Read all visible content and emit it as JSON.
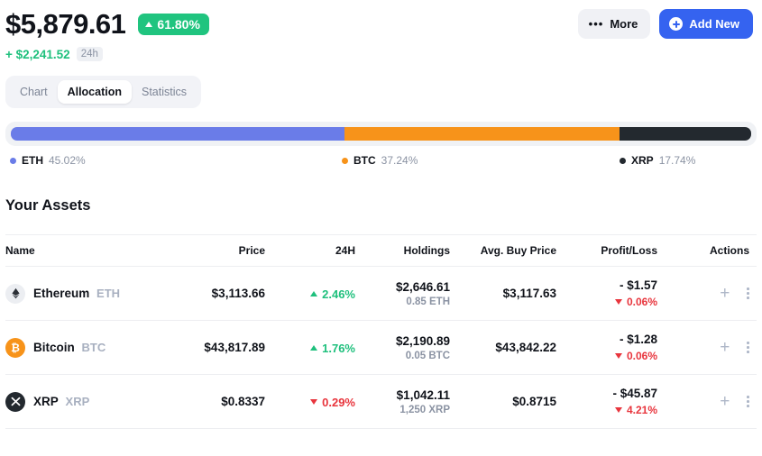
{
  "header": {
    "balance": "$5,879.61",
    "percent_badge": "61.80%",
    "change_value": "+ $2,241.52",
    "change_period": "24h",
    "more_label": "More",
    "more_dots": "•••",
    "add_new_label": "Add New"
  },
  "tabs": [
    {
      "label": "Chart",
      "active": false
    },
    {
      "label": "Allocation",
      "active": true
    },
    {
      "label": "Statistics",
      "active": false
    }
  ],
  "allocation": {
    "segments": [
      {
        "symbol": "ETH",
        "percent": "45.02%",
        "value": 45.02,
        "color": "#6a7ce8"
      },
      {
        "symbol": "BTC",
        "percent": "37.24%",
        "value": 37.24,
        "color": "#f7931a"
      },
      {
        "symbol": "XRP",
        "percent": "17.74%",
        "value": 17.74,
        "color": "#23292f"
      }
    ]
  },
  "assets_section": {
    "title": "Your Assets",
    "columns": [
      "Name",
      "Price",
      "24H",
      "Holdings",
      "Avg. Buy Price",
      "Profit/Loss",
      "Actions"
    ],
    "rows": [
      {
        "name": "Ethereum",
        "symbol": "ETH",
        "icon": "ethereum-icon",
        "price": "$3,113.66",
        "change_24h": "2.46%",
        "change_dir": "up",
        "holdings_value": "$2,646.61",
        "holdings_amount": "0.85 ETH",
        "avg_buy_price": "$3,117.63",
        "pl_value": "- $1.57",
        "pl_percent": "0.06%",
        "pl_dir": "down"
      },
      {
        "name": "Bitcoin",
        "symbol": "BTC",
        "icon": "bitcoin-icon",
        "price": "$43,817.89",
        "change_24h": "1.76%",
        "change_dir": "up",
        "holdings_value": "$2,190.89",
        "holdings_amount": "0.05 BTC",
        "avg_buy_price": "$43,842.22",
        "pl_value": "- $1.28",
        "pl_percent": "0.06%",
        "pl_dir": "down"
      },
      {
        "name": "XRP",
        "symbol": "XRP",
        "icon": "xrp-icon",
        "price": "$0.8337",
        "change_24h": "0.29%",
        "change_dir": "down",
        "holdings_value": "$1,042.11",
        "holdings_amount": "1,250 XRP",
        "avg_buy_price": "$0.8715",
        "pl_value": "- $45.87",
        "pl_percent": "4.21%",
        "pl_dir": "down"
      }
    ]
  },
  "colors": {
    "accent": "#3563f0",
    "positive": "#1fc07d",
    "negative": "#e8353d",
    "eth": "#6a7ce8",
    "btc": "#f7931a",
    "xrp": "#23292f"
  }
}
